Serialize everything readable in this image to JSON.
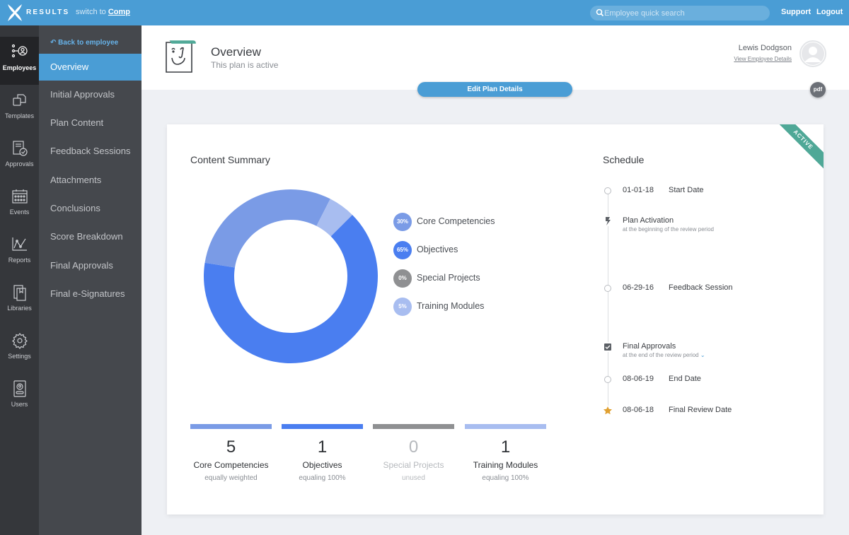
{
  "topbar": {
    "logo_text": "RESULTS",
    "switch_prefix": "switch to",
    "switch_link": "Comp",
    "search_placeholder": "Employee quick search",
    "support": "Support",
    "logout": "Logout"
  },
  "rail": {
    "items": [
      {
        "label": "Employees",
        "icon": "employees-icon",
        "active": true
      },
      {
        "label": "Templates",
        "icon": "templates-icon"
      },
      {
        "label": "Approvals",
        "icon": "approvals-icon"
      },
      {
        "label": "Events",
        "icon": "calendar-icon"
      },
      {
        "label": "Reports",
        "icon": "chart-icon"
      },
      {
        "label": "Libraries",
        "icon": "library-icon"
      },
      {
        "label": "Settings",
        "icon": "gear-icon"
      },
      {
        "label": "Users",
        "icon": "user-badge-icon"
      }
    ]
  },
  "subnav": {
    "back": "Back to employee",
    "items": [
      {
        "label": "Overview",
        "active": true
      },
      {
        "label": "Initial Approvals"
      },
      {
        "label": "Plan Content"
      },
      {
        "label": "Feedback Sessions"
      },
      {
        "label": "Attachments"
      },
      {
        "label": "Conclusions"
      },
      {
        "label": "Score Breakdown"
      },
      {
        "label": "Final Approvals"
      },
      {
        "label": "Final e-Signatures"
      }
    ]
  },
  "header": {
    "title": "Overview",
    "subtitle": "This plan is active",
    "employee_name": "Lewis Dodgson",
    "employee_link": "View Employee Details",
    "pdf": "pdf",
    "edit_button": "Edit Plan Details"
  },
  "card": {
    "ribbon": "ACTIVE",
    "content_title": "Content Summary",
    "schedule_title": "Schedule"
  },
  "colors": {
    "core": "#7a9be6",
    "objectives": "#4a7ef0",
    "special": "#8f9092",
    "training": "#a8bdf0",
    "accent": "#4a9dd5",
    "ribbon": "#4fa897",
    "star": "#e0a030"
  },
  "chart_data": {
    "type": "pie",
    "variant": "donut",
    "title": "Content Summary",
    "categories": [
      "Core Competencies",
      "Objectives",
      "Special Projects",
      "Training Modules"
    ],
    "values": [
      30,
      65,
      0,
      5
    ],
    "value_labels": [
      "30%",
      "65%",
      "0%",
      "5%"
    ],
    "colors": [
      "#7a9be6",
      "#4a7ef0",
      "#8f9092",
      "#a8bdf0"
    ],
    "legend_position": "right"
  },
  "stats": [
    {
      "count": "5",
      "label": "Core Competencies",
      "sub": "equally weighted",
      "color": "#7a9be6"
    },
    {
      "count": "1",
      "label": "Objectives",
      "sub": "equaling 100%",
      "color": "#4a7ef0"
    },
    {
      "count": "0",
      "label": "Special Projects",
      "sub": "unused",
      "color": "#8f9092",
      "muted": true
    },
    {
      "count": "1",
      "label": "Training Modules",
      "sub": "equaling 100%",
      "color": "#a8bdf0"
    }
  ],
  "schedule": [
    {
      "type": "circle",
      "date": "01-01-18",
      "label": "Start Date"
    },
    {
      "type": "bolt",
      "title": "Plan Activation",
      "sub": "at the beginning of the review period"
    },
    {
      "type": "circle",
      "date": "06-29-16",
      "label": "Feedback Session"
    },
    {
      "type": "check",
      "title": "Final Approvals",
      "sub": "at the end of the review period"
    },
    {
      "type": "circle",
      "date": "08-06-19",
      "label": "End Date"
    },
    {
      "type": "star",
      "date": "08-06-18",
      "label": "Final Review Date"
    }
  ]
}
